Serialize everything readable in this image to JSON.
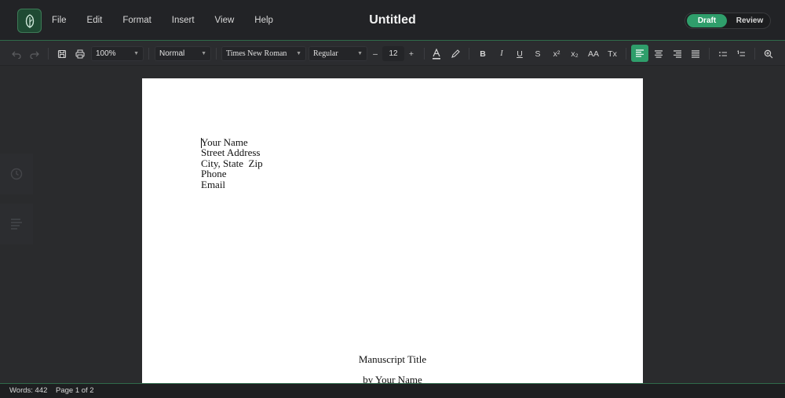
{
  "app": {
    "title": "Untitled",
    "menu": [
      "File",
      "Edit",
      "Format",
      "Insert",
      "View",
      "Help"
    ],
    "modes": {
      "active": "Draft",
      "inactive": "Review"
    },
    "accent": "#2f9e6b"
  },
  "toolbar": {
    "zoom": "100%",
    "style": "Normal",
    "font": "Times New Roman",
    "weight": "Regular",
    "size": "12",
    "decrease": "–",
    "increase": "+",
    "bold": "B",
    "italic": "I",
    "underline": "U",
    "strike": "S",
    "superscript": "x²",
    "subscript": "x₂",
    "case": "AA",
    "clear": "Tx"
  },
  "document": {
    "address_lines": [
      "Your Name",
      "Street Address",
      "City, State  Zip",
      "Phone",
      "Email"
    ],
    "manuscript_title": "Manuscript Title",
    "byline": "by Your Name"
  },
  "status": {
    "words": "Words: 442",
    "page": "Page 1 of 2"
  }
}
